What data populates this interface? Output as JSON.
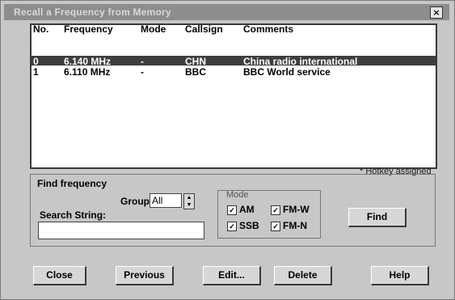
{
  "window": {
    "title": "Recall a Frequency from Memory",
    "close_glyph": "×"
  },
  "table": {
    "headers": {
      "no": "No.",
      "frequency": "Frequency",
      "mode": "Mode",
      "callsign": "Callsign",
      "comments": "Comments"
    },
    "rows": [
      {
        "no": "0",
        "frequency": "6.140 MHz",
        "mode": "-",
        "callsign": "CHN",
        "comments": "China radio international"
      },
      {
        "no": "1",
        "frequency": "6.110 MHz",
        "mode": "-",
        "callsign": "BBC",
        "comments": "BBC World service"
      }
    ]
  },
  "hotkey_note": "* Hotkey assigned",
  "find": {
    "legend": "Find frequency",
    "group_label": "Group:",
    "group_value": "All",
    "search_label": "Search String:",
    "search_value": "",
    "mode_legend": "Mode",
    "modes": {
      "am": "AM",
      "ssb": "SSB",
      "fmw": "FM-W",
      "fmn": "FM-N"
    },
    "check_glyph": "✓",
    "find_button": "Find"
  },
  "buttons": {
    "close": "Close",
    "previous": "Previous",
    "edit": "Edit...",
    "delete": "Delete",
    "help": "Help"
  }
}
